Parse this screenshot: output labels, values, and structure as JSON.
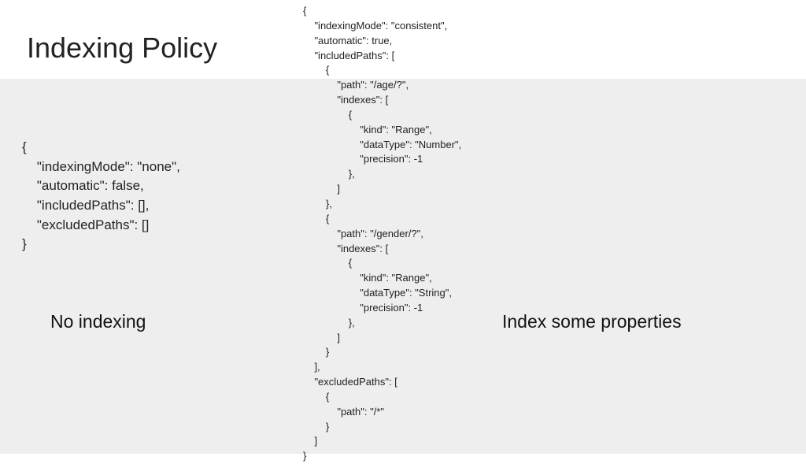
{
  "slide": {
    "title": "Indexing Policy",
    "left": {
      "code": "{\n    \"indexingMode\": \"none\",\n    \"automatic\": false,\n    \"includedPaths\": [],\n    \"excludedPaths\": []\n}",
      "caption": "No indexing"
    },
    "right": {
      "code": "{\n    \"indexingMode\": \"consistent\",\n    \"automatic\": true,\n    \"includedPaths\": [\n        {\n            \"path\": \"/age/?\",\n            \"indexes\": [\n                {\n                    \"kind\": \"Range\",\n                    \"dataType\": \"Number\",\n                    \"precision\": -1\n                },\n            ]\n        },\n        {\n            \"path\": \"/gender/?\",\n            \"indexes\": [\n                {\n                    \"kind\": \"Range\",\n                    \"dataType\": \"String\",\n                    \"precision\": -1\n                },\n            ]\n        }\n    ],\n    \"excludedPaths\": [\n        {\n            \"path\": \"/*\"\n        }\n    ]\n}",
      "caption": "Index some properties"
    }
  }
}
